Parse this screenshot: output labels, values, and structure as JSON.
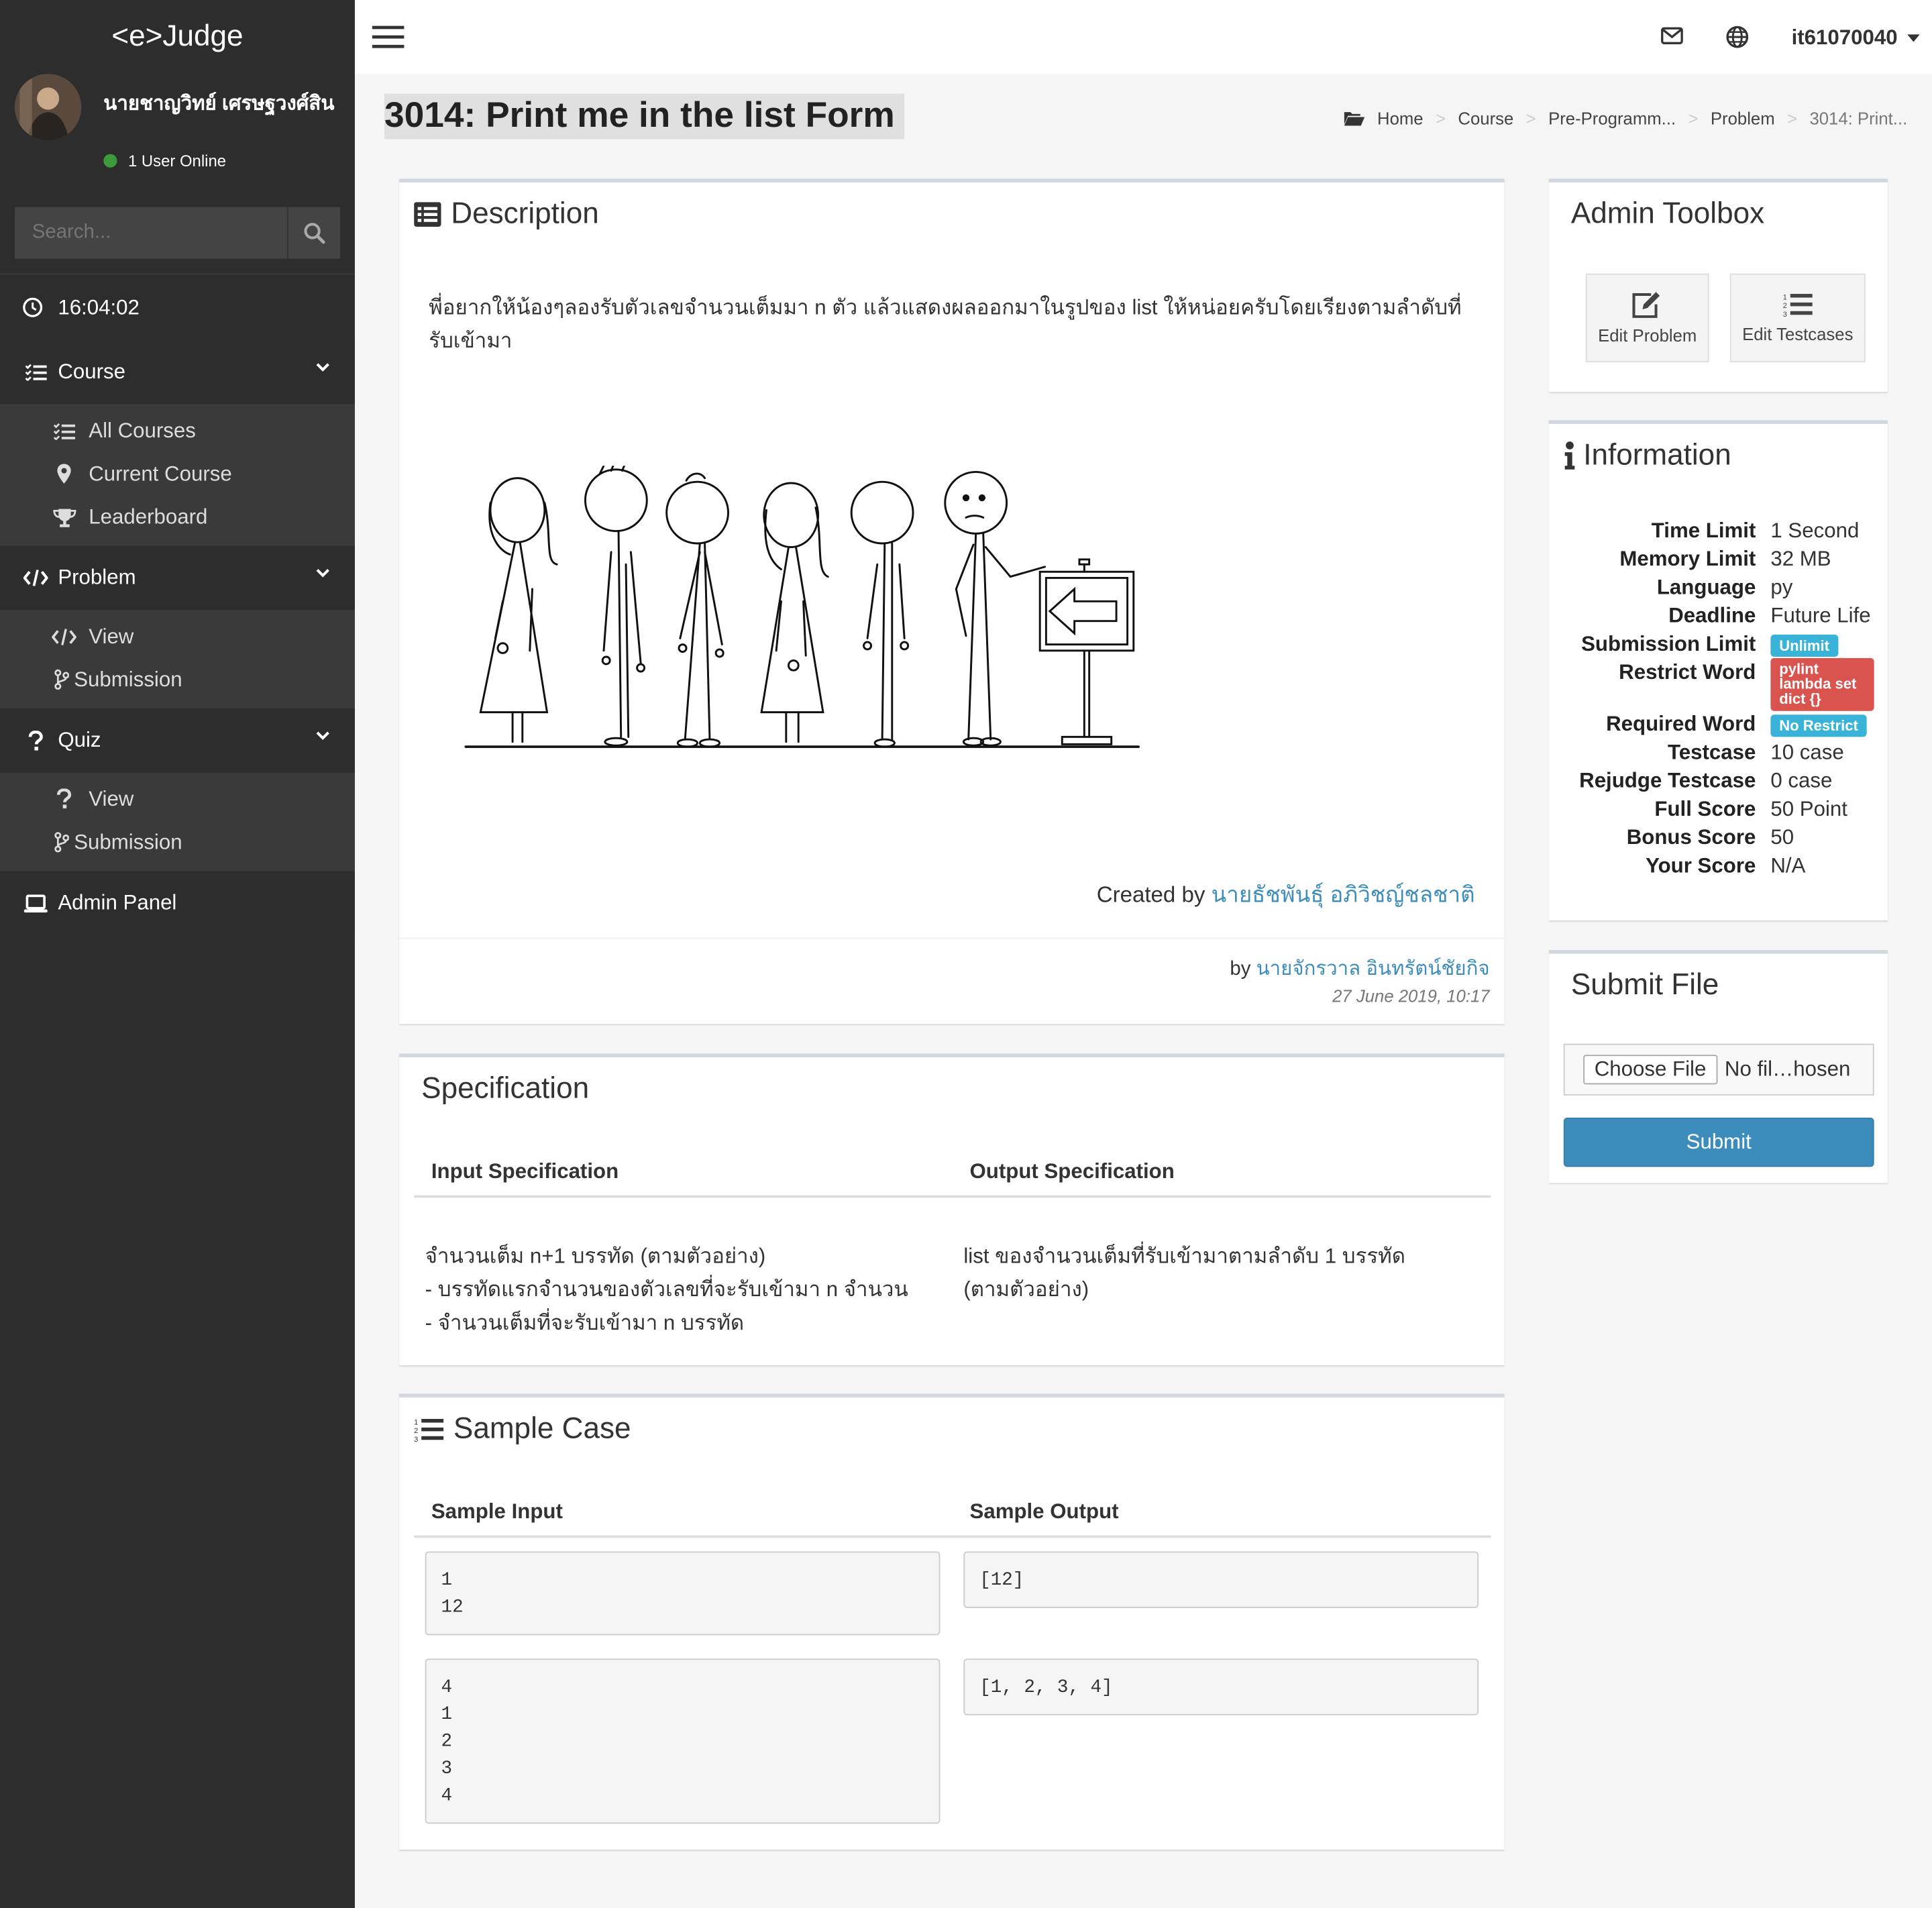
{
  "app": {
    "brand": "<e>Judge"
  },
  "user": {
    "name": "นายชาญวิทย์ เศรษฐวงศ์สิน",
    "status": "1 User Online",
    "username": "it61070040"
  },
  "search": {
    "placeholder": "Search..."
  },
  "clock": "16:04:02",
  "menu": {
    "course": {
      "label": "Course",
      "items": [
        {
          "label": "All Courses",
          "icon": "list-check-icon"
        },
        {
          "label": "Current Course",
          "icon": "map-marker-icon"
        },
        {
          "label": "Leaderboard",
          "icon": "trophy-icon"
        }
      ]
    },
    "problem": {
      "label": "Problem",
      "items": [
        {
          "label": "View",
          "icon": "code-icon"
        },
        {
          "label": "Submission",
          "icon": "code-branch-icon"
        }
      ]
    },
    "quiz": {
      "label": "Quiz",
      "items": [
        {
          "label": "View",
          "icon": "question-icon"
        },
        {
          "label": "Submission",
          "icon": "code-branch-icon"
        }
      ]
    },
    "admin": {
      "label": "Admin Panel",
      "icon": "laptop-icon"
    }
  },
  "page": {
    "title": "3014: Print me in the list Form"
  },
  "breadcrumb": [
    "Home",
    "Course",
    "Pre-Programm...",
    "Problem",
    "3014: Print..."
  ],
  "description": {
    "title": "Description",
    "text": "พี่อยากให้น้องๆลองรับตัวเลขจำนวนเต็มมา n ตัว แล้วแสดงผลออกมาในรูปของ list ให้หน่อยครับโดยเรียงตามลำดับที่รับเข้ามา",
    "created_prefix": "Created by",
    "created_by": "นายธัชพันธุ์ อภิวิชญ์ชลชาติ",
    "by_prefix": "by",
    "by": "นายจักรวาล อินทรัตน์ชัยกิจ",
    "date": "27 June 2019, 10:17"
  },
  "specification": {
    "title": "Specification",
    "input_header": "Input Specification",
    "output_header": "Output Specification",
    "input_text": "จำนวนเต็ม n+1 บรรทัด (ตามตัวอย่าง)\n- บรรทัดแรกจำนวนของตัวเลขที่จะรับเข้ามา n จำนวน\n- จำนวนเต็มที่จะรับเข้ามา n บรรทัด",
    "output_text": "list ของจำนวนเต็มที่รับเข้ามาตามลำดับ 1 บรรทัด\n(ตามตัวอย่าง)"
  },
  "samples": {
    "title": "Sample Case",
    "input_header": "Sample Input",
    "output_header": "Sample Output",
    "cases": [
      {
        "input": "1\n12",
        "output": "[12]"
      },
      {
        "input": "4\n1\n2\n3\n4",
        "output": "[1, 2, 3, 4]"
      }
    ]
  },
  "toolbox": {
    "title": "Admin Toolbox",
    "edit_problem": "Edit Problem",
    "edit_testcases": "Edit Testcases"
  },
  "information": {
    "title": "Information",
    "time_limit_label": "Time Limit",
    "time_limit": "1 Second",
    "memory_limit_label": "Memory Limit",
    "memory_limit": "32 MB",
    "language_label": "Language",
    "language": "py",
    "deadline_label": "Deadline",
    "deadline": "Future Life",
    "submission_limit_label": "Submission Limit",
    "submission_limit": "Unlimit",
    "restrict_word_label": "Restrict Word",
    "restrict_word": "pylint lambda set dict {}",
    "required_word_label": "Required Word",
    "required_word": "No Restrict",
    "testcase_label": "Testcase",
    "testcase": "10 case",
    "rejudge_label": "Rejudge Testcase",
    "rejudge": "0 case",
    "full_score_label": "Full Score",
    "full_score": "50 Point",
    "bonus_score_label": "Bonus Score",
    "bonus_score": "50",
    "your_score_label": "Your Score",
    "your_score": "N/A"
  },
  "submit": {
    "title": "Submit File",
    "choose_label": "Choose File",
    "file_status": "No fil…hosen",
    "button": "Submit"
  },
  "colors": {
    "sidebar": "#2d2d2d",
    "accent": "#3c8dbc",
    "badge_info": "#39b3d7",
    "badge_danger": "#d9534f"
  }
}
